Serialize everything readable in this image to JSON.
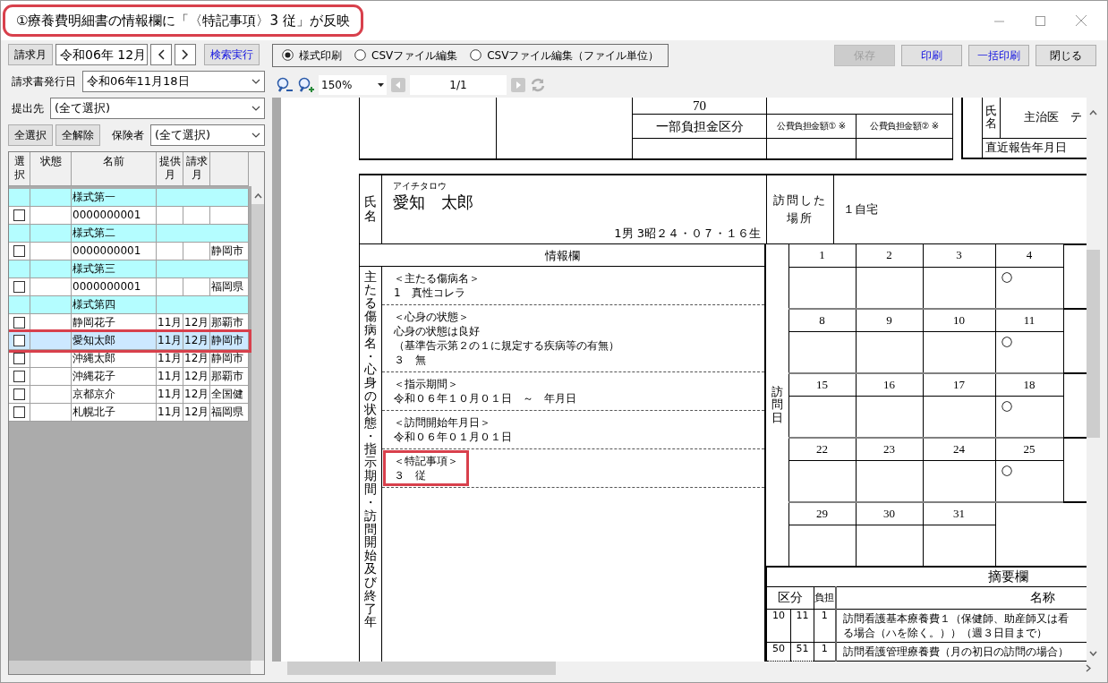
{
  "window": {
    "title": "①療養費明細書の情報欄に「〈特記事項〉3 従」が反映",
    "highlighted": true
  },
  "filters": {
    "billing_month": {
      "label": "請求月",
      "value": "令和06年 12月"
    },
    "search_button": "検索実行",
    "issue_date": {
      "label": "請求書発行日",
      "value": "令和06年11月18日"
    },
    "submit_to": {
      "label": "提出先",
      "value": "(全て選択)"
    },
    "select_all": "全選択",
    "clear_all": "全解除",
    "insurer": {
      "label": "保険者",
      "value": "(全て選択)"
    }
  },
  "patient_list": {
    "columns": [
      "選択",
      "状態",
      "名前",
      "提供月",
      "請求月"
    ],
    "rows": [
      {
        "kind": "group",
        "name": "様式第一"
      },
      {
        "kind": "patient",
        "checked": false,
        "selected": false,
        "highlighted": false,
        "name": "0000000001"
      },
      {
        "kind": "group",
        "name": "様式第二"
      },
      {
        "kind": "patient",
        "checked": false,
        "selected": false,
        "highlighted": false,
        "name": "0000000001",
        "column_6": "静岡市"
      },
      {
        "kind": "group",
        "name": "様式第三"
      },
      {
        "kind": "patient",
        "checked": false,
        "selected": false,
        "highlighted": false,
        "name": "0000000001",
        "column_6": "福岡県"
      },
      {
        "kind": "group",
        "name": "様式第四"
      },
      {
        "kind": "patient",
        "checked": false,
        "selected": false,
        "highlighted": false,
        "name": "静岡花子",
        "provided": "11月",
        "billed": "12月",
        "column_6": "那覇市"
      },
      {
        "kind": "patient",
        "checked": false,
        "selected": true,
        "highlighted": true,
        "name": "愛知太郎",
        "provided": "11月",
        "billed": "12月",
        "column_6": "静岡市"
      },
      {
        "kind": "patient",
        "checked": false,
        "selected": false,
        "highlighted": false,
        "name": "沖縄太郎",
        "provided": "11月",
        "billed": "12月",
        "column_6": "静岡市"
      },
      {
        "kind": "patient",
        "checked": false,
        "selected": false,
        "highlighted": false,
        "name": "沖縄花子",
        "provided": "11月",
        "billed": "12月",
        "column_6": "那覇市"
      },
      {
        "kind": "patient",
        "checked": false,
        "selected": false,
        "highlighted": false,
        "name": "京都京介",
        "provided": "11月",
        "billed": "12月",
        "column_6": "全国健"
      },
      {
        "kind": "patient",
        "checked": false,
        "selected": false,
        "highlighted": false,
        "name": "札幌北子",
        "provided": "11月",
        "billed": "12月",
        "column_6": "福岡県"
      }
    ]
  },
  "output_modes": [
    {
      "label": "様式印刷",
      "selected": true
    },
    {
      "label": "CSVファイル編集",
      "selected": false
    },
    {
      "label": "CSVファイル編集（ファイル単位）",
      "selected": false
    }
  ],
  "actions": [
    {
      "label": "保存",
      "disabled": true,
      "accent": false
    },
    {
      "label": "印刷",
      "disabled": false,
      "accent": true
    },
    {
      "label": "一括印刷",
      "disabled": false,
      "accent": true
    },
    {
      "label": "閉じる",
      "disabled": false,
      "accent": false
    }
  ],
  "viewer": {
    "zoom": "150%",
    "page": "1/1"
  },
  "document": {
    "header": {
      "number": "70",
      "copay_class": "一部負担金区分",
      "public_1": "公費負担金額① ※",
      "public_2": "公費負担金額② ※",
      "name_label": "氏名",
      "doctor": "主治医　テ",
      "report_date": "直近報告年月日"
    },
    "patient": {
      "label": "氏名",
      "kana": "アイチタロウ",
      "name": "愛知　太郎",
      "details": "1男 3昭２４・０７・１６生",
      "place_label": "訪問した場所",
      "place": "１自宅"
    },
    "info": {
      "title": "情報欄",
      "side_label": "主たる傷病名・心身の状態・指示期間・訪問開始及び終了年",
      "sections": [
        {
          "lines": [
            "＜主たる傷病名＞",
            "1　真性コレラ"
          ]
        },
        {
          "lines": [
            "＜心身の状態＞",
            "心身の状態は良好",
            "（基準告示第２の１に規定する疾病等の有無）",
            "３　無"
          ]
        },
        {
          "lines": [
            "＜指示期間＞",
            "令和０６年１０月０１日　～　年月日"
          ]
        },
        {
          "lines": [
            "＜訪問開始年月日＞",
            "令和０６年０１月０１日"
          ]
        },
        {
          "lines": [
            "＜特記事項＞",
            "３　従"
          ],
          "highlighted": true
        }
      ]
    },
    "calendar": {
      "label": "訪問日",
      "weeks": [
        [
          {
            "day": "1"
          },
          {
            "day": "2"
          },
          {
            "day": "3"
          },
          {
            "day": "4",
            "mark": "○"
          }
        ],
        [
          {
            "day": "8"
          },
          {
            "day": "9"
          },
          {
            "day": "10"
          },
          {
            "day": "11",
            "mark": "○"
          }
        ],
        [
          {
            "day": "15"
          },
          {
            "day": "16"
          },
          {
            "day": "17"
          },
          {
            "day": "18",
            "mark": "○"
          }
        ],
        [
          {
            "day": "22"
          },
          {
            "day": "23"
          },
          {
            "day": "24"
          },
          {
            "day": "25",
            "mark": "○"
          }
        ],
        [
          {
            "day": "29"
          },
          {
            "day": "30"
          },
          {
            "day": "31"
          }
        ]
      ]
    },
    "summary": {
      "title": "摘要欄",
      "columns": [
        "区分",
        "負担",
        "名称"
      ],
      "rows": [
        {
          "code_1": "10",
          "code_2": "11",
          "burden": "1",
          "name_lines": [
            "訪問看護基本療養費１（保健師、助産師又は看",
            "る場合（ハを除く。））（週３日目まで）"
          ]
        },
        {
          "code_1": "50",
          "code_2": "51",
          "burden": "1",
          "name_lines": [
            "訪問看護管理療養費（月の初日の訪問の場合）"
          ]
        }
      ]
    }
  }
}
